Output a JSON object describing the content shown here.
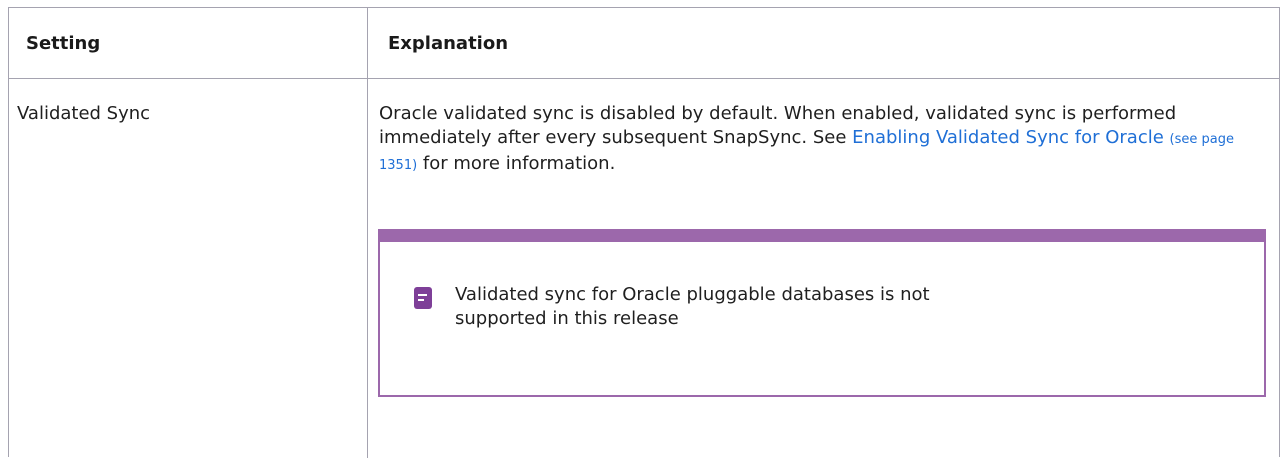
{
  "table": {
    "headers": {
      "setting": "Setting",
      "explanation": "Explanation"
    },
    "row": {
      "setting": "Validated Sync",
      "explanation": {
        "before_link": "Oracle validated sync is disabled by default. When enabled, validated sync is performed immediately after every subsequent SnapSync. See ",
        "link_text": "Enabling Validated Sync for Oracle",
        "page_ref": "(see page 1351)",
        "after_link": " for more information."
      }
    }
  },
  "note": {
    "icon": "note-icon",
    "text": "Validated sync for Oracle pluggable databases is not supported in this release"
  },
  "colors": {
    "border": "#a5a3b0",
    "link": "#1f6fd6",
    "note_border": "#9c68ab",
    "note_icon": "#7e3f98"
  }
}
